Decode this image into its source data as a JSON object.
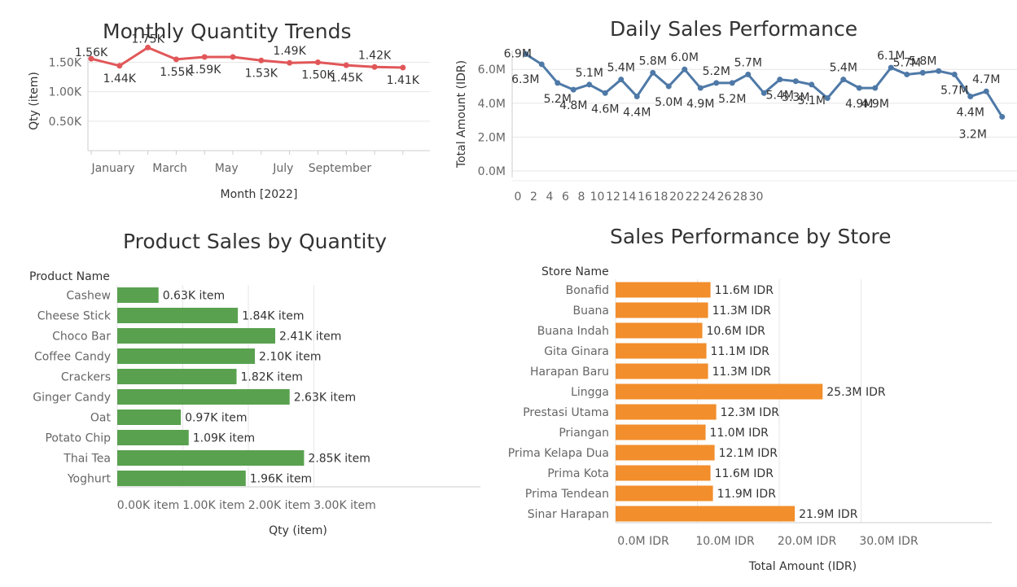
{
  "colors": {
    "monthly": "#e15759",
    "daily": "#4e79a7",
    "product": "#59a14f",
    "store": "#f28e2b",
    "grid": "#e6e6e6",
    "text": "#333333",
    "axis": "#666666"
  },
  "monthly": {
    "title": "Monthly Quantity Trends",
    "chart_data": {
      "type": "line",
      "title": "Monthly Quantity Trends",
      "xlabel": "Month [2022]",
      "ylabel": "Qty (item)",
      "x_ticks": [
        "January",
        "March",
        "May",
        "July",
        "September"
      ],
      "y_ticks": [
        "0.50K",
        "1.00K",
        "1.50K"
      ],
      "ylim": [
        0,
        1700
      ],
      "months": [
        1,
        2,
        3,
        4,
        5,
        6,
        7,
        8,
        9,
        10,
        11,
        12
      ],
      "values": [
        1560,
        1440,
        1750,
        1550,
        1590,
        1590,
        1530,
        1490,
        1500,
        1450,
        1420,
        1410
      ],
      "labels": [
        "1.56K",
        "1.44K",
        "1.75K",
        "1.55K",
        "1.59K",
        "",
        "1.53K",
        "1.49K",
        "1.50K",
        "1.45K",
        "1.42K",
        "1.41K"
      ]
    }
  },
  "daily": {
    "title": "Daily Sales Performance",
    "chart_data": {
      "type": "line",
      "title": "Daily Sales Performance",
      "ylabel": "Total Amount (IDR)",
      "x_ticks": [
        "0",
        "2",
        "4",
        "6",
        "8",
        "10",
        "12",
        "14",
        "16",
        "18",
        "20",
        "22",
        "24",
        "26",
        "28",
        "30"
      ],
      "y_ticks": [
        "0.0M",
        "2.0M",
        "4.0M",
        "6.0M"
      ],
      "ylim": [
        0,
        7
      ],
      "days": [
        1,
        2,
        3,
        4,
        5,
        6,
        7,
        8,
        9,
        10,
        11,
        12,
        13,
        14,
        15,
        16,
        17,
        18,
        19,
        20,
        21,
        22,
        23,
        24,
        25,
        26,
        27,
        28,
        29,
        30,
        31
      ],
      "values": [
        6.9,
        6.3,
        5.2,
        4.8,
        5.1,
        4.6,
        5.4,
        4.4,
        5.8,
        5.0,
        6.0,
        4.9,
        5.2,
        5.2,
        5.7,
        4.6,
        5.4,
        5.3,
        5.1,
        4.3,
        5.4,
        4.9,
        4.9,
        6.1,
        5.7,
        5.8,
        5.9,
        5.7,
        4.4,
        4.7,
        3.2
      ],
      "labels": [
        "6.9M",
        "6.3M",
        "5.2M",
        "4.8M",
        "5.1M",
        "4.6M",
        "5.4M",
        "4.4M",
        "5.8M",
        "5.0M",
        "6.0M",
        "4.9M",
        "5.2M",
        "5.2M",
        "5.7M",
        "",
        "5.4M",
        "5.3M",
        "5.1M",
        "",
        "5.4M",
        "4.9M",
        "4.9M",
        "6.1M",
        "5.7M",
        "5.8M",
        "",
        "5.7M",
        "4.4M",
        "4.7M",
        "3.2M"
      ]
    }
  },
  "product": {
    "title": "Product Sales by Quantity",
    "row_header": "Product Name",
    "chart_data": {
      "type": "bar",
      "orientation": "horizontal",
      "title": "Product Sales by Quantity",
      "xlabel": "Qty (item)",
      "categories": [
        "Cashew",
        "Cheese Stick",
        "Choco Bar",
        "Coffee Candy",
        "Crackers",
        "Ginger Candy",
        "Oat",
        "Potato Chip",
        "Thai Tea",
        "Yoghurt"
      ],
      "values": [
        630,
        1840,
        2410,
        2100,
        1820,
        2630,
        970,
        1090,
        2850,
        1960
      ],
      "labels": [
        "0.63K item",
        "1.84K item",
        "2.41K item",
        "2.10K item",
        "1.82K item",
        "2.63K item",
        "0.97K item",
        "1.09K item",
        "2.85K item",
        "1.96K item"
      ],
      "x_ticks": [
        "0.00K item",
        "1.00K item",
        "2.00K item",
        "3.00K item"
      ],
      "xlim": [
        0,
        3500
      ]
    }
  },
  "store": {
    "title": "Sales Performance by Store",
    "row_header": "Store Name",
    "chart_data": {
      "type": "bar",
      "orientation": "horizontal",
      "title": "Sales Performance by Store",
      "xlabel": "Total Amount (IDR)",
      "categories": [
        "Bonafid",
        "Buana",
        "Buana Indah",
        "Gita Ginara",
        "Harapan Baru",
        "Lingga",
        "Prestasi Utama",
        "Priangan",
        "Prima Kelapa Dua",
        "Prima Kota",
        "Prima Tendean",
        "Sinar Harapan"
      ],
      "values": [
        11.6,
        11.3,
        10.6,
        11.1,
        11.3,
        25.3,
        12.3,
        11.0,
        12.1,
        11.6,
        11.9,
        21.9
      ],
      "labels": [
        "11.6M IDR",
        "11.3M IDR",
        "10.6M IDR",
        "11.1M IDR",
        "11.3M IDR",
        "25.3M IDR",
        "12.3M IDR",
        "11.0M IDR",
        "12.1M IDR",
        "11.6M IDR",
        "11.9M IDR",
        "21.9M IDR"
      ],
      "x_ticks": [
        "0.0M IDR",
        "10.0M IDR",
        "20.0M IDR",
        "30.0M IDR"
      ],
      "xlim": [
        0,
        32
      ]
    }
  }
}
